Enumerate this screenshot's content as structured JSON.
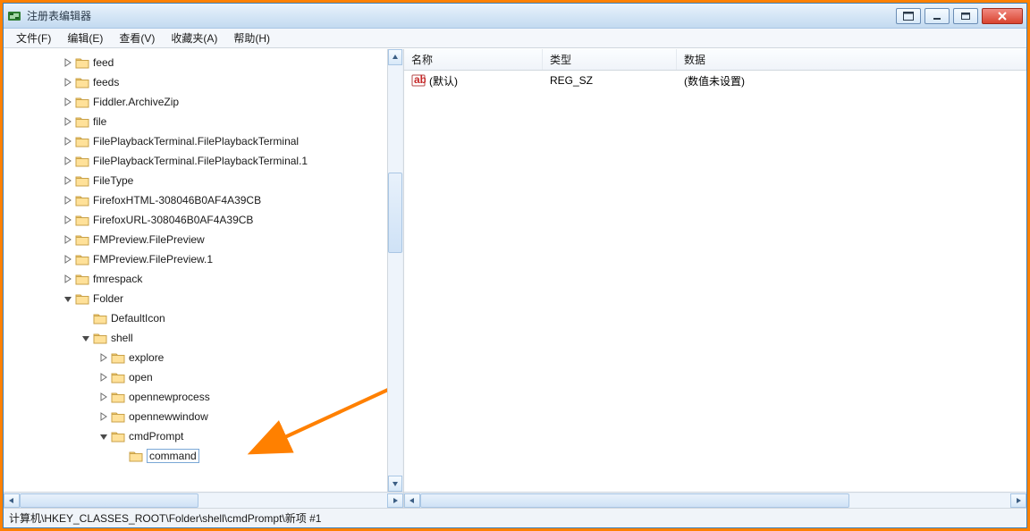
{
  "window": {
    "title": "注册表编辑器"
  },
  "menu": {
    "file": "文件(F)",
    "edit": "编辑(E)",
    "view": "查看(V)",
    "favorites": "收藏夹(A)",
    "help": "帮助(H)"
  },
  "tree": {
    "items": [
      {
        "indent": 3,
        "expander": "closed",
        "label": "feed"
      },
      {
        "indent": 3,
        "expander": "closed",
        "label": "feeds"
      },
      {
        "indent": 3,
        "expander": "closed",
        "label": "Fiddler.ArchiveZip"
      },
      {
        "indent": 3,
        "expander": "closed",
        "label": "file"
      },
      {
        "indent": 3,
        "expander": "closed",
        "label": "FilePlaybackTerminal.FilePlaybackTerminal"
      },
      {
        "indent": 3,
        "expander": "closed",
        "label": "FilePlaybackTerminal.FilePlaybackTerminal.1"
      },
      {
        "indent": 3,
        "expander": "closed",
        "label": "FileType"
      },
      {
        "indent": 3,
        "expander": "closed",
        "label": "FirefoxHTML-308046B0AF4A39CB"
      },
      {
        "indent": 3,
        "expander": "closed",
        "label": "FirefoxURL-308046B0AF4A39CB"
      },
      {
        "indent": 3,
        "expander": "closed",
        "label": "FMPreview.FilePreview"
      },
      {
        "indent": 3,
        "expander": "closed",
        "label": "FMPreview.FilePreview.1"
      },
      {
        "indent": 3,
        "expander": "closed",
        "label": "fmrespack"
      },
      {
        "indent": 3,
        "expander": "open",
        "label": "Folder"
      },
      {
        "indent": 4,
        "expander": "none",
        "label": "DefaultIcon"
      },
      {
        "indent": 4,
        "expander": "open",
        "label": "shell"
      },
      {
        "indent": 5,
        "expander": "closed",
        "label": "explore"
      },
      {
        "indent": 5,
        "expander": "closed",
        "label": "open"
      },
      {
        "indent": 5,
        "expander": "closed",
        "label": "opennewprocess"
      },
      {
        "indent": 5,
        "expander": "closed",
        "label": "opennewwindow"
      },
      {
        "indent": 5,
        "expander": "open",
        "label": "cmdPrompt"
      },
      {
        "indent": 6,
        "expander": "none",
        "label": "command",
        "editing": true
      }
    ]
  },
  "list": {
    "columns": {
      "name": "名称",
      "type": "类型",
      "data": "数据"
    },
    "rows": [
      {
        "name": "(默认)",
        "type": "REG_SZ",
        "data": "(数值未设置)"
      }
    ]
  },
  "status": {
    "path": "计算机\\HKEY_CLASSES_ROOT\\Folder\\shell\\cmdPrompt\\新项 #1"
  }
}
